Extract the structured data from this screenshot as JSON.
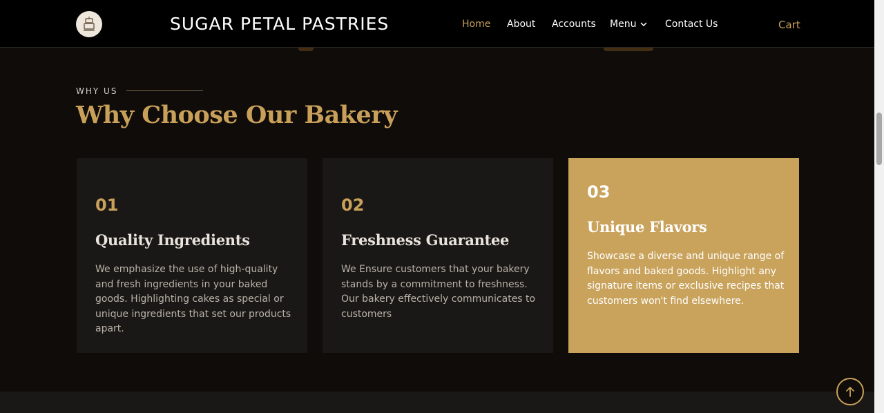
{
  "header": {
    "brand": "SUGAR PETAL PASTRIES",
    "logo_icon": "cake-logo",
    "nav": [
      {
        "label": "Home",
        "active": true
      },
      {
        "label": "About",
        "active": false
      },
      {
        "label": "Accounts",
        "active": false
      },
      {
        "label": "Menu",
        "active": false,
        "dropdown": true
      },
      {
        "label": "Contact Us",
        "active": false
      }
    ],
    "cart": "Cart"
  },
  "section": {
    "eyebrow": "WHY US",
    "title": "Why Choose Our Bakery"
  },
  "cards": [
    {
      "number": "01",
      "title": "Quality Ingredients",
      "text": "We emphasize the use of high-quality and fresh ingredients in your baked goods. Highlighting cakes as special or unique ingredients that set our products apart."
    },
    {
      "number": "02",
      "title": "Freshness Guarantee",
      "text": "We Ensure customers that your bakery stands by a commitment to freshness. Our bakery effectively communicates to customers"
    },
    {
      "number": "03",
      "title": "Unique Flavors",
      "text": "Showcase a diverse and unique range of flavors and baked goods. Highlight any signature items or exclusive recipes that customers won't find elsewhere."
    }
  ],
  "scroll_top_icon": "arrow-up-icon",
  "colors": {
    "accent": "#c9a05a",
    "card_bg": "#1a1816",
    "featured_card_bg": "#c9a35c",
    "page_bg": "#0f0c0a"
  }
}
